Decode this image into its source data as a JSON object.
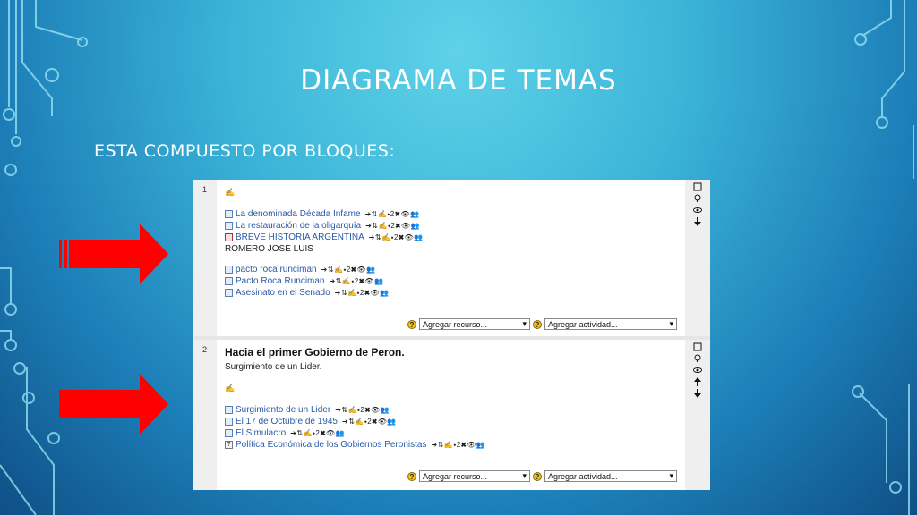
{
  "slide": {
    "title": "DIAGRAMA DE TEMAS",
    "subtitle": "ESTA COMPUESTO POR BLOQUES:"
  },
  "colors": {
    "arrow": "#ff0000",
    "link": "#2a5aa8",
    "background": "#3bb4d8"
  },
  "edit_icons": "➔⇅✍⬩2✖👁👥",
  "sections": [
    {
      "number": "1",
      "items": [
        {
          "label": "La denominada Década Infame",
          "kind": "link",
          "icon": "resource"
        },
        {
          "label": "La restauración de la oligarquía",
          "kind": "link",
          "icon": "resource"
        },
        {
          "label": "BREVE HISTORIA ARGENTINA",
          "kind": "link",
          "icon": "pdf"
        },
        {
          "label": "ROMERO JOSE LUIS",
          "kind": "text"
        },
        {
          "label": "pacto roca runciman",
          "kind": "link",
          "icon": "resource"
        },
        {
          "label": "Pacto Roca Runciman",
          "kind": "link",
          "icon": "resource"
        },
        {
          "label": "Asesinato en el Senado",
          "kind": "link",
          "icon": "resource"
        }
      ],
      "add_resource": "Agregar recurso...",
      "add_activity": "Agregar actividad..."
    },
    {
      "number": "2",
      "heading": "Hacia el primer Gobierno de Peron.",
      "summary": "Surgimiento de un Lider.",
      "items": [
        {
          "label": "Surgimiento de un Lider",
          "kind": "link",
          "icon": "resource"
        },
        {
          "label": "El 17 de Octubre de 1945",
          "kind": "link",
          "icon": "resource"
        },
        {
          "label": "El Simulacro",
          "kind": "link",
          "icon": "resource"
        },
        {
          "label": "Política Económica de los Gobiernos Peronistas",
          "kind": "link",
          "icon": "quiz"
        }
      ],
      "add_resource": "Agregar recurso...",
      "add_activity": "Agregar actividad..."
    }
  ]
}
